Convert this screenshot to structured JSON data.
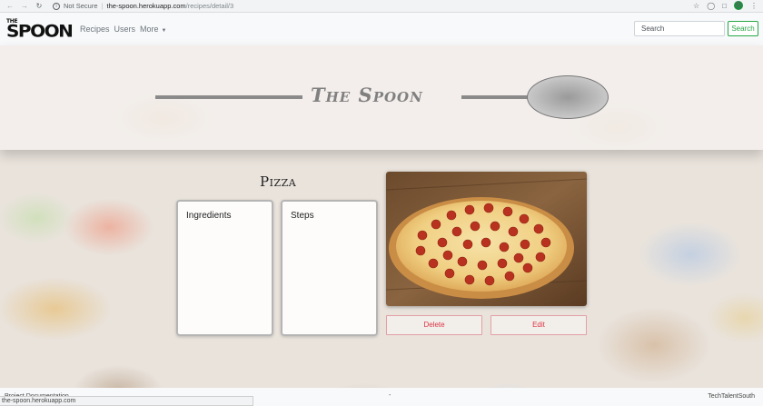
{
  "browser": {
    "security_label": "Not Secure",
    "url_host": "the-spoon.herokuapp.com",
    "url_path": "/recipes/detail/3",
    "profile_initial": "B",
    "status_url": "the-spoon.herokuapp.com"
  },
  "navbar": {
    "logo_small": "THE",
    "logo_big": "SPOON",
    "links": [
      "Recipes",
      "Users",
      "More"
    ],
    "search_placeholder": "Search",
    "search_button": "Search"
  },
  "hero": {
    "title": "The Spoon"
  },
  "recipe": {
    "title": "Pizza",
    "ingredients_label": "Ingredients",
    "steps_label": "Steps",
    "delete_label": "Delete",
    "edit_label": "Edit"
  },
  "footer": {
    "left": "Project Documentation",
    "middle": "-",
    "right": "TechTalentSouth"
  },
  "colors": {
    "accent_green": "#28a745",
    "danger_red": "#dc3545"
  }
}
